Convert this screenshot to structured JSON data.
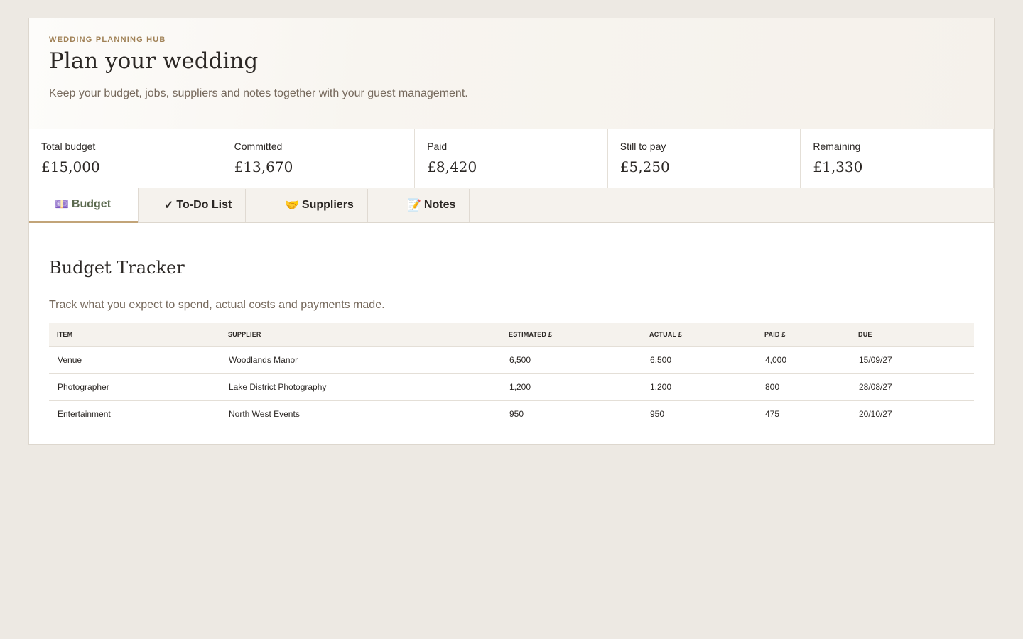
{
  "header": {
    "eyebrow": "WEDDING PLANNING HUB",
    "title": "Plan your wedding",
    "subtitle": "Keep your budget, jobs, suppliers and notes together with your guest management."
  },
  "stats": [
    {
      "label": "Total budget",
      "value": "£15,000"
    },
    {
      "label": "Committed",
      "value": "£13,670"
    },
    {
      "label": "Paid",
      "value": "£8,420"
    },
    {
      "label": "Still to pay",
      "value": "£5,250"
    },
    {
      "label": "Remaining",
      "value": "£1,330"
    }
  ],
  "tabs": [
    {
      "icon": "💷",
      "icon_name": "banknote-icon",
      "label": "Budget",
      "active": true
    },
    {
      "icon": "✓",
      "icon_name": "checkmark-icon",
      "label": "To-Do List",
      "active": false
    },
    {
      "icon": "🤝",
      "icon_name": "handshake-icon",
      "label": "Suppliers",
      "active": false
    },
    {
      "icon": "📝",
      "icon_name": "memo-icon",
      "label": "Notes",
      "active": false
    }
  ],
  "section": {
    "title": "Budget Tracker",
    "subtitle": "Track what you expect to spend, actual costs and payments made."
  },
  "table": {
    "columns": [
      "ITEM",
      "SUPPLIER",
      "ESTIMATED £",
      "ACTUAL £",
      "PAID £",
      "DUE"
    ],
    "rows": [
      [
        "Venue",
        "Woodlands Manor",
        "6,500",
        "6,500",
        "4,000",
        "15/09/27"
      ],
      [
        "Photographer",
        "Lake District Photography",
        "1,200",
        "1,200",
        "800",
        "28/08/27"
      ],
      [
        "Entertainment",
        "North West Events",
        "950",
        "950",
        "475",
        "20/10/27"
      ]
    ]
  },
  "colors": {
    "accent": "#c2a478",
    "eyebrow": "#a08156",
    "active_tab_text": "#5b6a4f",
    "page_background": "#ede9e3"
  }
}
